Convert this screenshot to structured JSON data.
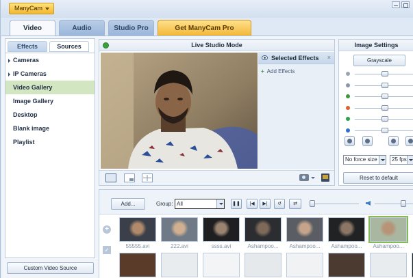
{
  "app": {
    "menu_label": "ManyCam"
  },
  "tabs": [
    {
      "label": "Video"
    },
    {
      "label": "Audio"
    },
    {
      "label": "Studio Pro"
    },
    {
      "label": "Get ManyCam Pro"
    }
  ],
  "left_panel": {
    "subtabs": [
      "Effects",
      "Sources"
    ],
    "sources": [
      {
        "label": "Cameras"
      },
      {
        "label": "IP Cameras"
      },
      {
        "label": "Video Gallery"
      },
      {
        "label": "Image Gallery"
      },
      {
        "label": "Desktop"
      },
      {
        "label": "Blank image"
      },
      {
        "label": "Playlist"
      }
    ],
    "custom_source_button": "Custom Video Source"
  },
  "studio": {
    "title": "Live Studio Mode",
    "selected_effects_title": "Selected Effects",
    "close_glyph": "×",
    "add_effects_label": "Add Effects"
  },
  "image_settings": {
    "title": "Image Settings",
    "grayscale_button": "Grayscale",
    "force_size": "No force size",
    "fps": "25 fps",
    "reset_button": "Reset to default",
    "sliders": [
      {
        "icon": "brightness-icon",
        "color": "#9aa6b6",
        "value": 0.5
      },
      {
        "icon": "contrast-icon",
        "color": "#8a96a8",
        "value": 0.5
      },
      {
        "icon": "saturation-icon",
        "color": "#3a9a3a",
        "value": 0.5
      },
      {
        "icon": "red-channel-icon",
        "color": "#e0622a",
        "value": 0.5
      },
      {
        "icon": "green-channel-icon",
        "color": "#2ea24a",
        "value": 0.5
      },
      {
        "icon": "blue-channel-icon",
        "color": "#2f6fcf",
        "value": 0.5
      }
    ]
  },
  "gallery": {
    "add_button": "Add...",
    "group_label": "Group:",
    "group_value": "All",
    "playback": [
      "❚❚",
      "|◀",
      "▶|",
      "↺",
      "⇄"
    ],
    "thumbnails": [
      {
        "label": "55555.avi"
      },
      {
        "label": "222.avi"
      },
      {
        "label": "ssss.avi"
      },
      {
        "label": "Ashampoo..."
      },
      {
        "label": "Ashampoo..."
      },
      {
        "label": "Ashampoo..."
      },
      {
        "label": "Ashampoo..."
      }
    ],
    "thumbnail_row2_count": 8
  }
}
